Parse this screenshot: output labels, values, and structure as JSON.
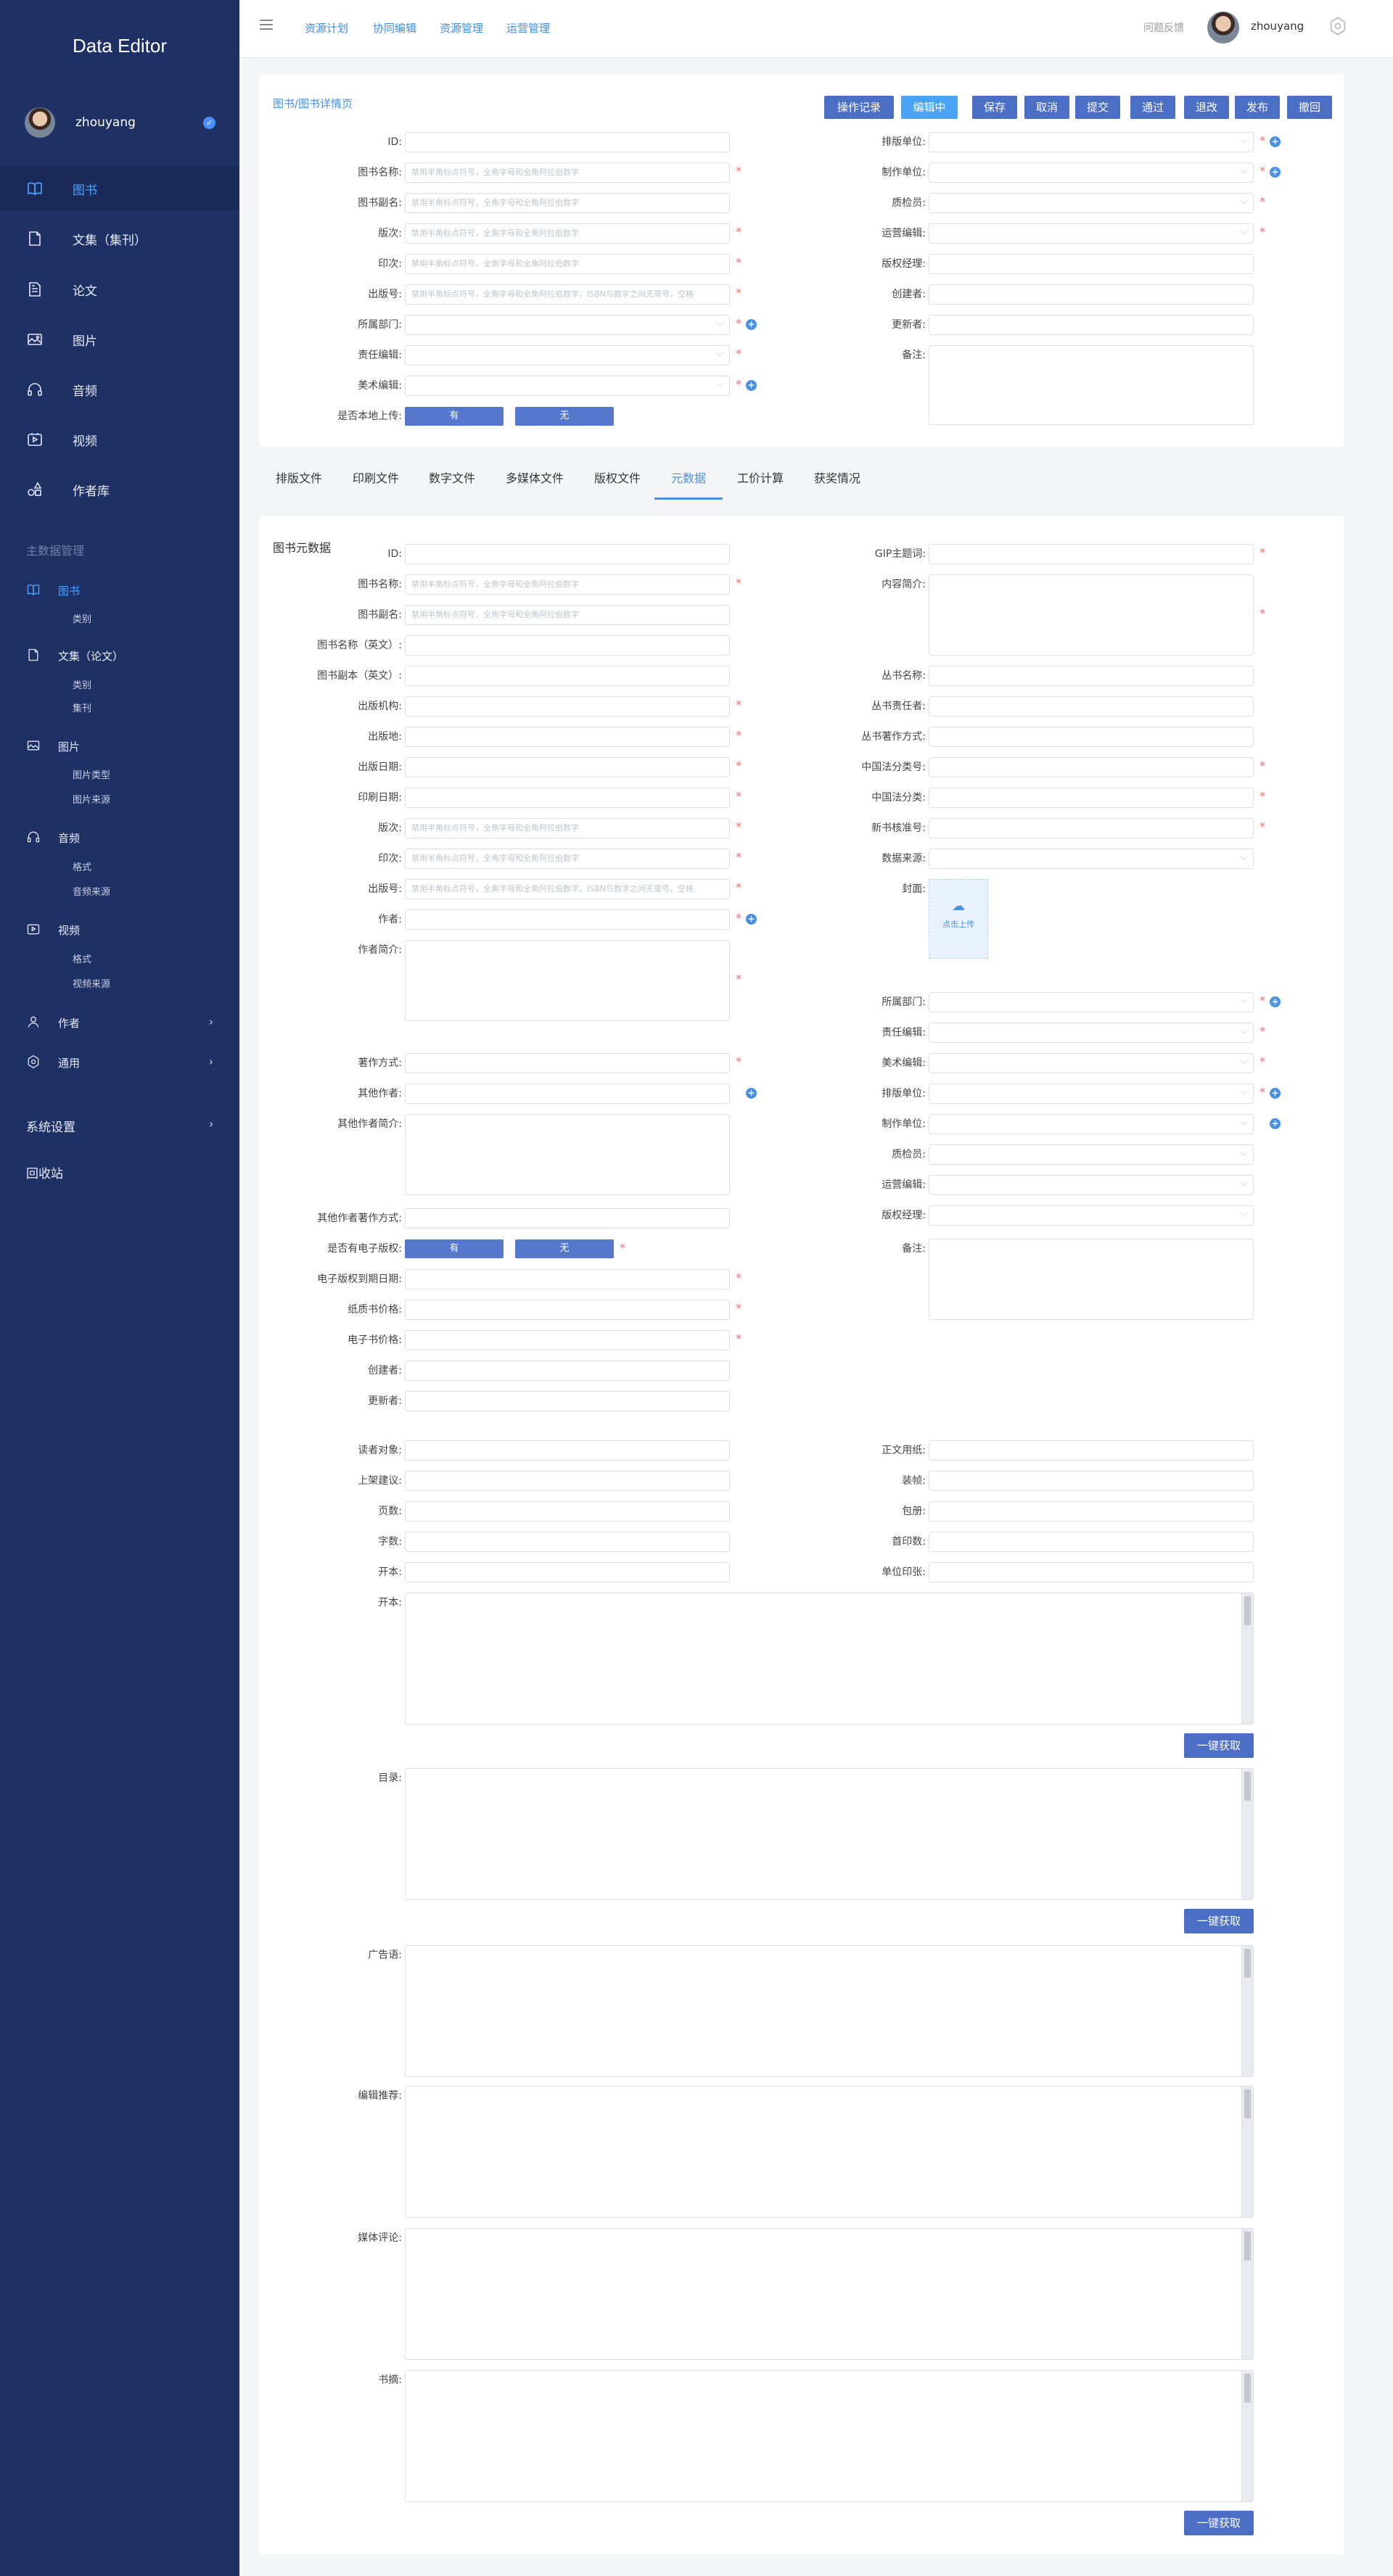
{
  "app": {
    "title": "Data Editor"
  },
  "user": {
    "name": "zhouyang"
  },
  "sidebar": {
    "main": [
      "图书",
      "文集（集刊）",
      "论文",
      "图片",
      "音频",
      "视频",
      "作者库"
    ],
    "section_title": "主数据管理",
    "groups": [
      {
        "label": "图书",
        "subs": [
          "类别"
        ]
      },
      {
        "label": "文集（论文）",
        "subs": [
          "类别",
          "集刊"
        ]
      },
      {
        "label": "图片",
        "subs": [
          "图片类型",
          "图片来源"
        ]
      },
      {
        "label": "音频",
        "subs": [
          "格式",
          "音频来源"
        ]
      },
      {
        "label": "视频",
        "subs": [
          "格式",
          "视频来源"
        ]
      },
      {
        "label": "作者",
        "subs": []
      },
      {
        "label": "通用",
        "subs": []
      }
    ],
    "system": "系统设置",
    "recycle": "回收站"
  },
  "topbar": {
    "links": [
      "资源计划",
      "协同编辑",
      "资源管理",
      "运营管理"
    ],
    "feedback": "问题反馈"
  },
  "detail": {
    "breadcrumb": "图书/图书详情页",
    "buttons": [
      "操作记录",
      "编辑中",
      "保存",
      "取消",
      "提交",
      "通过",
      "退改",
      "发布",
      "撤回"
    ],
    "left": [
      {
        "label": "ID:",
        "ph": ""
      },
      {
        "label": "图书名称:",
        "ph": "禁用半角标点符号，全角字母和全角阿拉伯数字"
      },
      {
        "label": "图书副名:",
        "ph": "禁用半角标点符号，全角字母和全角阿拉伯数字"
      },
      {
        "label": "版次:",
        "ph": "禁用半角标点符号，全角字母和全角阿拉伯数字"
      },
      {
        "label": "印次:",
        "ph": "禁用半角标点符号，全角字母和全角阿拉伯数字"
      },
      {
        "label": "出版号:",
        "ph": "禁用半角标点符号，全角字母和全角阿拉伯数字，ISBN与数字之间无需号，空格"
      },
      {
        "label": "所属部门:",
        "ph": ""
      },
      {
        "label": "责任编辑:",
        "ph": ""
      },
      {
        "label": "美术编辑:",
        "ph": ""
      },
      {
        "label": "是否本地上传:",
        "ph": ""
      }
    ],
    "right": [
      "排版单位:",
      "制作单位:",
      "质检员:",
      "运营编辑:",
      "版权经理:",
      "创建者:",
      "更新者:",
      "备注:"
    ],
    "yes": "有",
    "no": "无"
  },
  "tabs": [
    "排版文件",
    "印刷文件",
    "数字文件",
    "多媒体文件",
    "版权文件",
    "元数据",
    "工价计算",
    "获奖情况"
  ],
  "meta": {
    "title": "图书元数据",
    "placeholder": "禁用半角标点符号，全角字母和全角阿拉伯数字",
    "placeholder_isbn": "禁用半角标点符号，全角字母和全角阿拉伯数字，ISBN与数字之间无需号，空格",
    "left": [
      "ID:",
      "图书名称:",
      "图书副名:",
      "图书名称（英文）:",
      "图书副本（英文）:",
      "出版机构:",
      "出版地:",
      "出版日期:",
      "印刷日期:",
      "版次:",
      "印次:",
      "出版号:",
      "作者:",
      "作者简介:",
      "著作方式:",
      "其他作者:",
      "其他作者简介:",
      "其他作者著作方式:",
      "是否有电子版权:",
      "电子版权到期日期:",
      "纸质书价格:",
      "电子书价格:",
      "创建者:",
      "更新者:"
    ],
    "right": [
      "GIP主题词:",
      "内容简介:",
      "丛书名称:",
      "丛书责任者:",
      "丛书著作方式:",
      "中国法分类号:",
      "中国法分类:",
      "新书核准号:",
      "数据来源:",
      "封面:",
      "所属部门:",
      "责任编辑:",
      "美术编辑:",
      "排版单位:",
      "制作单位:",
      "质检员:",
      "运营编辑:",
      "版权经理:",
      "备注:"
    ],
    "upload": "点击上传",
    "extra_left": [
      "读者对象:",
      "上架建议:",
      "页数:",
      "字数:",
      "开本:"
    ],
    "extra_right": [
      "正文用纸:",
      "装帧:",
      "包册:",
      "首印数:",
      "单位印张:"
    ],
    "textareas": [
      "开本:",
      "目录:",
      "广告语:",
      "编辑推荐:",
      "媒体评论:",
      "书摘:"
    ],
    "fetch": "一键获取"
  }
}
